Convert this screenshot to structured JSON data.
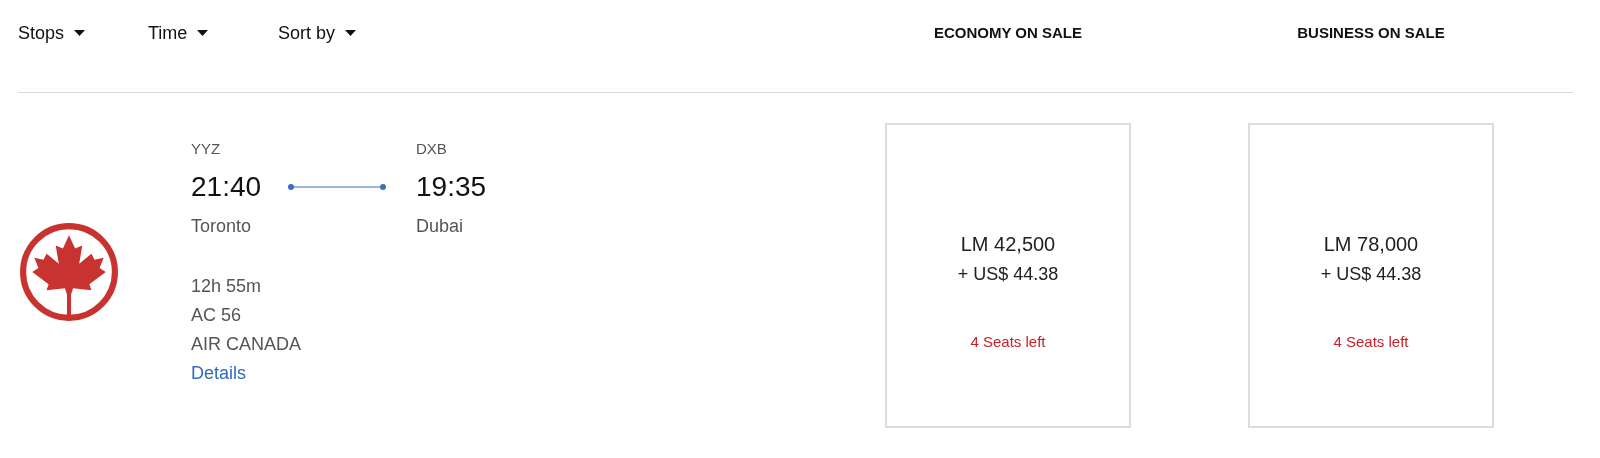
{
  "filters": [
    {
      "label": "Stops"
    },
    {
      "label": "Time"
    },
    {
      "label": "Sort by"
    }
  ],
  "fare_columns": [
    "ECONOMY ON SALE",
    "BUSINESS ON SALE"
  ],
  "flight": {
    "origin": {
      "code": "YYZ",
      "time": "21:40",
      "city": "Toronto"
    },
    "destination": {
      "code": "DXB",
      "time": "19:35",
      "city": "Dubai"
    },
    "duration": "12h 55m",
    "flight_number": "AC 56",
    "airline": "AIR CANADA",
    "details_link": "Details"
  },
  "fares": [
    {
      "price": "LM 42,500",
      "taxes": "+ US$ 44.38",
      "seats": "4 Seats left"
    },
    {
      "price": "LM 78,000",
      "taxes": "+ US$ 44.38",
      "seats": "4 Seats left"
    }
  ]
}
